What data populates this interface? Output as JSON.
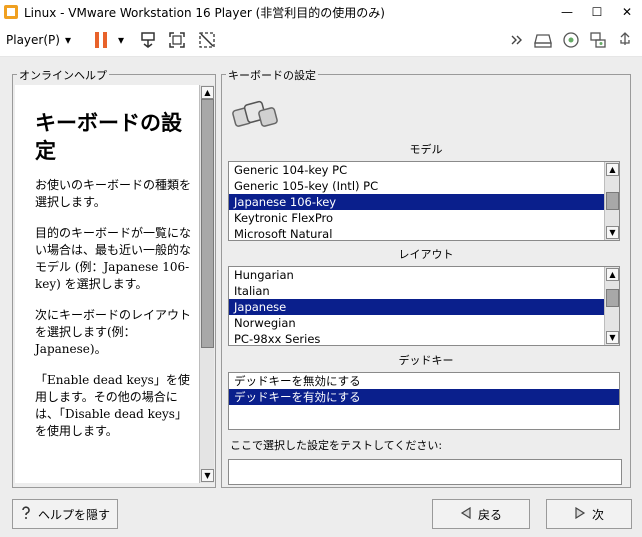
{
  "window": {
    "title": "Linux - VMware Workstation 16 Player (非営利目的の使用のみ)"
  },
  "window_controls": {
    "minimize": "—",
    "maximize": "☐",
    "close": "✕"
  },
  "toolbar": {
    "player_menu": "Player(P)",
    "player_arrow": "▾",
    "pause_arrow": "▾"
  },
  "help_panel": {
    "title": "オンラインヘルプ",
    "heading": "キーボードの設定",
    "paragraphs": [
      "お使いのキーボードの種類を選択します。",
      "目的のキーボードが一覧にない場合は、最も近い一般的なモデル (例：Japanese 106-key) を選択します。",
      "次にキーボードのレイアウトを選択します(例：Japanese)。",
      "「Enable dead keys」を使用します。その他の場合には、「Disable dead keys」を使用します。"
    ]
  },
  "keyboard_panel": {
    "title": "キーボードの設定",
    "model_label": "モデル",
    "model_items": [
      "Generic 104-key PC",
      "Generic 105-key (Intl) PC",
      "Japanese 106-key",
      "Keytronic FlexPro",
      "Microsoft Natural"
    ],
    "model_selected": "Japanese 106-key",
    "layout_label": "レイアウト",
    "layout_items": [
      "Hungarian",
      "Italian",
      "Japanese",
      "Norwegian",
      "PC-98xx Series"
    ],
    "layout_selected": "Japanese",
    "deadkey_label": "デッドキー",
    "deadkey_items": [
      "デッドキーを無効にする",
      "デッドキーを有効にする"
    ],
    "deadkey_selected": "デッドキーを有効にする",
    "test_label": "ここで選択した設定をテストしてください:",
    "test_value": ""
  },
  "footer": {
    "hide_help": "ヘルプを隠す",
    "back": "戻る",
    "next": "次"
  },
  "colors": {
    "selection": "#0a1f8c",
    "pause_icon": "#e8622a",
    "background": "#ededed"
  }
}
